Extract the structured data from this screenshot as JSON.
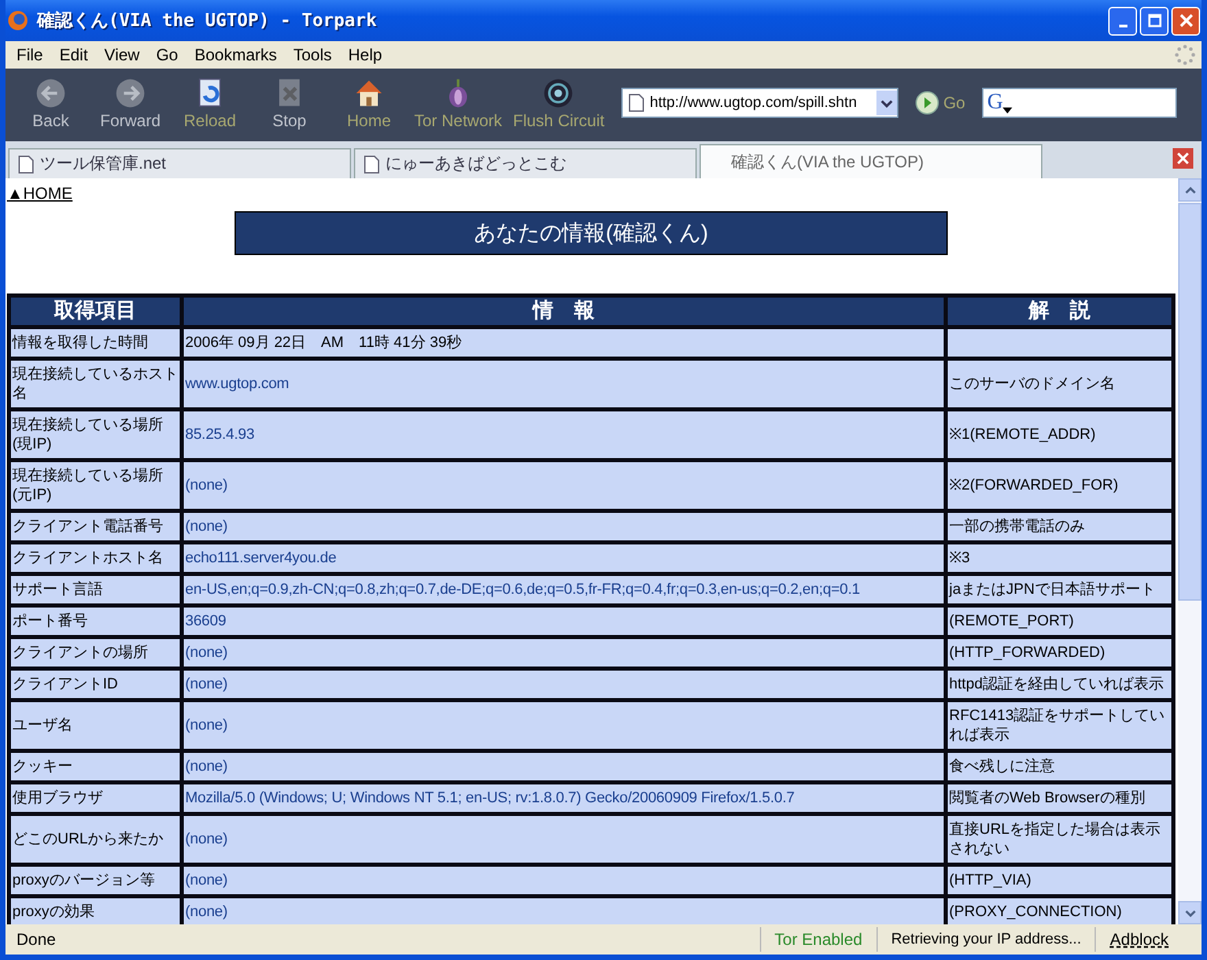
{
  "window": {
    "title": "確認くん(VIA the UGTOP) - Torpark"
  },
  "menu": [
    "File",
    "Edit",
    "View",
    "Go",
    "Bookmarks",
    "Tools",
    "Help"
  ],
  "toolbar": [
    {
      "label": "Back",
      "kind": "back",
      "disabled": true
    },
    {
      "label": "Forward",
      "kind": "forward",
      "disabled": true
    },
    {
      "label": "Reload",
      "kind": "reload",
      "disabled": false
    },
    {
      "label": "Stop",
      "kind": "stop",
      "disabled": true
    },
    {
      "label": "Home",
      "kind": "home",
      "disabled": false
    },
    {
      "label": "Tor Network",
      "kind": "onion",
      "disabled": false
    },
    {
      "label": "Flush Circuit",
      "kind": "circuit",
      "disabled": false
    }
  ],
  "address_bar": {
    "value": "http://www.ugtop.com/spill.shtn",
    "go": "Go"
  },
  "search": {
    "engine_letter": "G"
  },
  "tabs": [
    {
      "label": "ツール保管庫.net",
      "selected": false
    },
    {
      "label": "にゅーあきばどっとこむ",
      "selected": false
    },
    {
      "label": "確認くん(VIA the UGTOP)",
      "selected": true
    }
  ],
  "page": {
    "home_link": "▲HOME",
    "heading": "あなたの情報(確認くん)",
    "table": {
      "columns": [
        "取得項目",
        "情　報",
        "解　説"
      ],
      "rows": [
        {
          "item": "情報を取得した時間",
          "info": "2006年 09月 22日　AM　11時 41分 39秒",
          "kind": "plain",
          "note": ""
        },
        {
          "item": "現在接続しているホスト名",
          "info": "www.ugtop.com",
          "kind": "value",
          "note": "このサーバのドメイン名"
        },
        {
          "item": "現在接続している場所(現IP)",
          "info": "85.25.4.93",
          "kind": "value",
          "note": "※1(REMOTE_ADDR)"
        },
        {
          "item": "現在接続している場所(元IP)",
          "info": "(none)",
          "kind": "value",
          "note": "※2(FORWARDED_FOR)"
        },
        {
          "item": "クライアント電話番号",
          "info": "(none)",
          "kind": "value",
          "note": "一部の携帯電話のみ"
        },
        {
          "item": "クライアントホスト名",
          "info": "echo111.server4you.de",
          "kind": "value",
          "note": "※3"
        },
        {
          "item": "サポート言語",
          "info": "en-US,en;q=0.9,zh-CN;q=0.8,zh;q=0.7,de-DE;q=0.6,de;q=0.5,fr-FR;q=0.4,fr;q=0.3,en-us;q=0.2,en;q=0.1",
          "kind": "value",
          "note": "jaまたはJPNで日本語サポート"
        },
        {
          "item": "ポート番号",
          "info": "36609",
          "kind": "value",
          "note": "(REMOTE_PORT)"
        },
        {
          "item": "クライアントの場所",
          "info": "(none)",
          "kind": "value",
          "note": "(HTTP_FORWARDED)"
        },
        {
          "item": "クライアントID",
          "info": "(none)",
          "kind": "value",
          "note": "httpd認証を経由していれば表示"
        },
        {
          "item": "ユーザ名",
          "info": "(none)",
          "kind": "value",
          "note": "RFC1413認証をサポートしていれば表示"
        },
        {
          "item": "クッキー",
          "info": "(none)",
          "kind": "value",
          "note": "食べ残しに注意"
        },
        {
          "item": "使用ブラウザ",
          "info": "Mozilla/5.0 (Windows; U; Windows NT 5.1; en-US; rv:1.8.0.7) Gecko/20060909 Firefox/1.5.0.7",
          "kind": "value",
          "note": "閲覧者のWeb Browserの種別"
        },
        {
          "item": "どこのURLから来たか",
          "info": "(none)",
          "kind": "value",
          "note": "直接URLを指定した場合は表示されない"
        },
        {
          "item": "proxyのバージョン等",
          "info": "(none)",
          "kind": "value",
          "note": "(HTTP_VIA)"
        },
        {
          "item": "proxyの効果",
          "info": "(none)",
          "kind": "value",
          "note": "(PROXY_CONNECTION)"
        }
      ]
    }
  },
  "status_bar": {
    "status": "Done",
    "tor": "Tor Enabled",
    "message": "Retrieving your IP address...",
    "adblock": "Adblock"
  }
}
